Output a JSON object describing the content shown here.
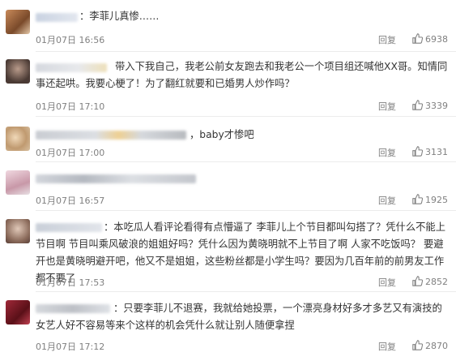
{
  "comments": [
    {
      "text": "：李菲儿真惨……",
      "time": "01月07日 16:56",
      "reply": "回复",
      "likes": "6938",
      "avatar_color": "#b57a4a"
    },
    {
      "text": "带入下我自己，我老公前女友跑去和我老公一个项目组还喊他XX哥。知情同事还起哄。我要心梗了！为了翻红就要和已婚男人炒作吗？",
      "time": "01月07日 17:10",
      "reply": "回复",
      "likes": "3339",
      "avatar_color": "#6e5a52"
    },
    {
      "text": "，baby才惨吧",
      "time": "01月07日 17:00",
      "reply": "回复",
      "likes": "3131",
      "avatar_color": "#c9a27a"
    },
    {
      "text": "",
      "time": "01月07日 16:57",
      "reply": "回复",
      "likes": "1925",
      "avatar_color": "#d7b7c4"
    },
    {
      "text": "：本吃瓜人看评论看得有点懵逼了 李菲儿上个节目都叫勾搭了？凭什么不能上节目啊 节目叫乘风破浪的姐姐好吗？凭什么因为黄晓明就不上节目了啊 人家不吃饭吗？ 要避开也是黄晓明避开吧，他又不是姐姐，这些粉丝都是小学生吗？要因为几百年前的前男友工作都不要了",
      "time": "01月07日 17:53",
      "reply": "回复",
      "likes": "2852",
      "avatar_color": "#9c7f70"
    },
    {
      "text": "：只要李菲儿不退赛，我就给她投票，一个漂亮身材好多才多艺又有演技的女艺人好不容易等来个这样的机会凭什么就让别人随便拿捏",
      "time": "01月07日 17:12",
      "reply": "回复",
      "likes": "2870",
      "avatar_color": "#7a2030"
    }
  ]
}
